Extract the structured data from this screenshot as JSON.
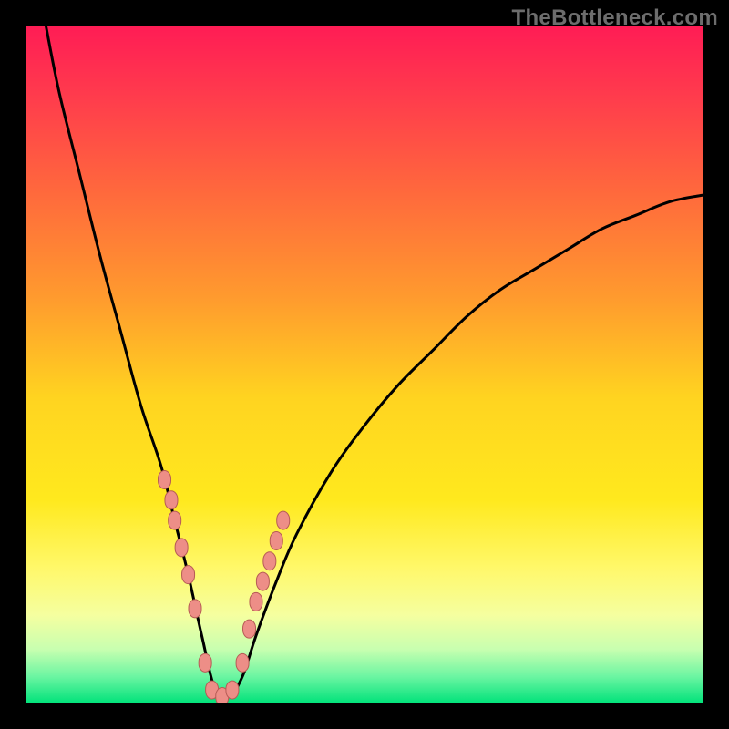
{
  "watermark": "TheBottleneck.com",
  "colors": {
    "frame": "#000000",
    "gradient_stops": [
      {
        "offset": 0.0,
        "color": "#ff1c55"
      },
      {
        "offset": 0.1,
        "color": "#ff3a4d"
      },
      {
        "offset": 0.25,
        "color": "#ff6a3c"
      },
      {
        "offset": 0.4,
        "color": "#ff9a2e"
      },
      {
        "offset": 0.55,
        "color": "#ffd420"
      },
      {
        "offset": 0.7,
        "color": "#ffe91e"
      },
      {
        "offset": 0.8,
        "color": "#fff86a"
      },
      {
        "offset": 0.87,
        "color": "#f5ffa0"
      },
      {
        "offset": 0.92,
        "color": "#c8ffb0"
      },
      {
        "offset": 0.96,
        "color": "#6cf5a2"
      },
      {
        "offset": 1.0,
        "color": "#00e27a"
      }
    ],
    "curve": "#000000",
    "marker_fill": "#ed8e87",
    "marker_stroke": "#b65b55"
  },
  "chart_data": {
    "type": "line",
    "title": "",
    "xlabel": "",
    "ylabel": "",
    "xlim": [
      0,
      100
    ],
    "ylim": [
      0,
      100
    ],
    "note": "V-shaped bottleneck curve. Axes are not labeled in the source image; x/y are normalized 0–100. The curve has a single minimum near x≈28 at y≈0 (green band), rising steeply toward y≈100 on the left edge and more gently toward y≈75 at the right edge.",
    "series": [
      {
        "name": "bottleneck-curve",
        "x": [
          3,
          5,
          8,
          11,
          14,
          17,
          20,
          22,
          24,
          26,
          28,
          30,
          32,
          34,
          37,
          40,
          45,
          50,
          55,
          60,
          65,
          70,
          75,
          80,
          85,
          90,
          95,
          100
        ],
        "y": [
          100,
          90,
          78,
          66,
          55,
          44,
          35,
          27,
          19,
          10,
          2,
          1,
          4,
          10,
          18,
          25,
          34,
          41,
          47,
          52,
          57,
          61,
          64,
          67,
          70,
          72,
          74,
          75
        ]
      }
    ],
    "markers": {
      "name": "highlighted-points",
      "note": "Pink lozenge markers clustered on both curve flanks near the minimum and at the very bottom.",
      "x": [
        20.5,
        21.5,
        22.0,
        23.0,
        24.0,
        25.0,
        26.5,
        27.5,
        29.0,
        30.5,
        32.0,
        33.0,
        34.0,
        35.0,
        36.0,
        37.0,
        38.0
      ],
      "y": [
        33,
        30,
        27,
        23,
        19,
        14,
        6,
        2,
        1,
        2,
        6,
        11,
        15,
        18,
        21,
        24,
        27
      ]
    }
  }
}
